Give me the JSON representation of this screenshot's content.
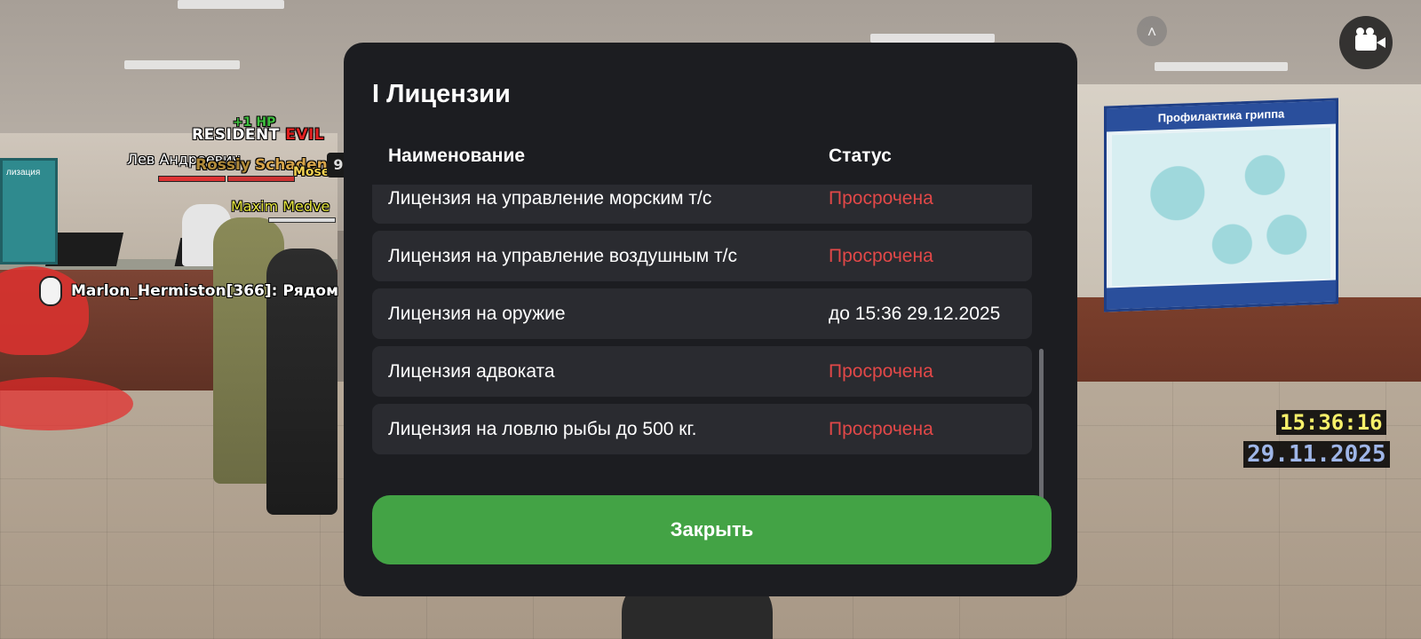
{
  "dialog": {
    "title": "I Лицензии",
    "columns": {
      "name": "Наименование",
      "status": "Статус"
    },
    "rows": [
      {
        "name": "Лицензия на управление морским т/с",
        "status": "Просрочена",
        "status_color": "#e24848"
      },
      {
        "name": "Лицензия на управление воздушным т/с",
        "status": "Просрочена",
        "status_color": "#e24848"
      },
      {
        "name": "Лицензия на оружие",
        "status": "до 15:36 29.12.2025",
        "status_color": "#ffffff"
      },
      {
        "name": "Лицензия адвоката",
        "status": "Просрочена",
        "status_color": "#e24848"
      },
      {
        "name": "Лицензия на ловлю рыбы до 500 кг.",
        "status": "Просрочена",
        "status_color": "#e24848"
      }
    ],
    "close_label": "Закрыть",
    "accent_color": "#43a345"
  },
  "hud": {
    "time": "15:36:16",
    "date": "29.11.2025",
    "chat_line": "Marlon_Hermiston[366]: Рядом",
    "hp_plus": "+1 HP",
    "gang_tag_white": "RESIDENT",
    "gang_tag_red": "EVIL",
    "nick_lev": "Лев Андреевич",
    "nick_rossiya": "Rossiy",
    "nick_schaden": "Schaden",
    "nick_moses": "Moses",
    "nick_maxim": "Maxim Medve",
    "bubble_number": "9",
    "camera_icon": "video-camera-icon",
    "up_icon": "chevron-up-icon"
  },
  "scene": {
    "poster_title": "Профилактика гриппа",
    "wall_label": "лизация"
  }
}
